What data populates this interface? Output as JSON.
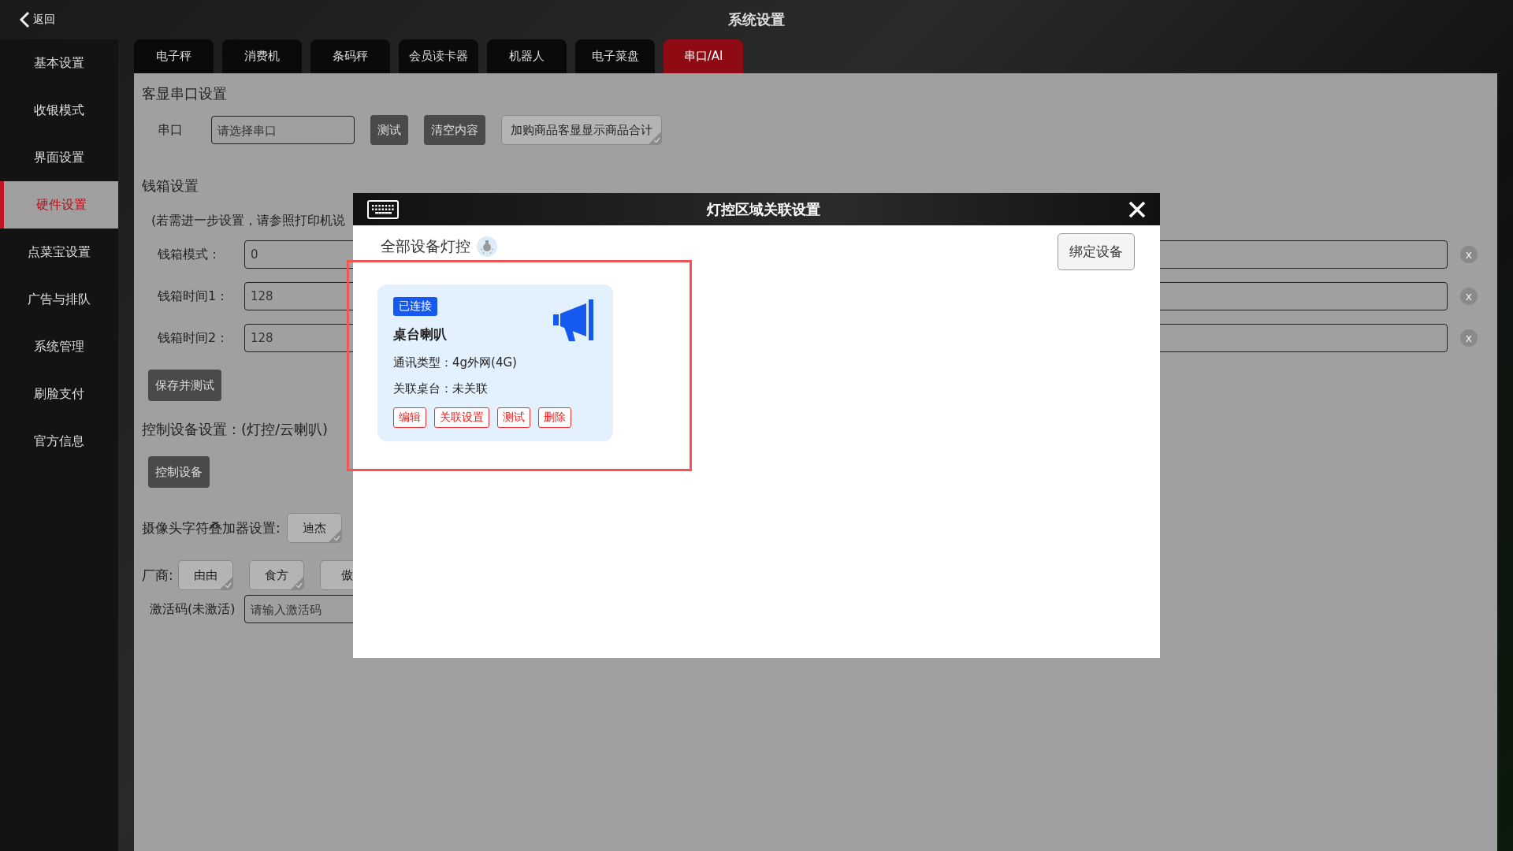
{
  "header": {
    "back": "返回",
    "title": "系统设置"
  },
  "sidebar": {
    "items": [
      {
        "label": "基本设置",
        "selected": false
      },
      {
        "label": "收银模式",
        "selected": false
      },
      {
        "label": "界面设置",
        "selected": false
      },
      {
        "label": "硬件设置",
        "selected": true
      },
      {
        "label": "点菜宝设置",
        "selected": false
      },
      {
        "label": "广告与排队",
        "selected": false
      },
      {
        "label": "系统管理",
        "selected": false
      },
      {
        "label": "刷脸支付",
        "selected": false
      },
      {
        "label": "官方信息",
        "selected": false
      }
    ]
  },
  "tabs": [
    {
      "label": "电子秤",
      "selected": false
    },
    {
      "label": "消费机",
      "selected": false
    },
    {
      "label": "条码秤",
      "selected": false
    },
    {
      "label": "会员读卡器",
      "selected": false
    },
    {
      "label": "机器人",
      "selected": false
    },
    {
      "label": "电子菜盘",
      "selected": false
    },
    {
      "label": "串口/AI",
      "selected": true
    }
  ],
  "display_port": {
    "heading": "客显串口设置",
    "label": "串口",
    "placeholder": "请选择串口",
    "buttons": [
      "测试",
      "清空内容"
    ],
    "option": "加购商品客显显示商品合计"
  },
  "cash_drawer": {
    "heading": "钱箱设置",
    "note": "(若需进一步设置，请参照打印机说",
    "fields": [
      {
        "label": "钱箱模式：",
        "value": "0",
        "clear": "x"
      },
      {
        "label": "钱箱时间1：",
        "value": "128",
        "clear": "x"
      },
      {
        "label": "钱箱时间2：",
        "value": "128",
        "clear": "x"
      }
    ],
    "button": "保存并测试"
  },
  "control": {
    "heading": "控制设备设置：(灯控/云喇叭)",
    "button": "控制设备"
  },
  "camera": {
    "label": "摄像头字符叠加器设置:",
    "option": "迪杰"
  },
  "vendors": {
    "label": "厂商:",
    "options": [
      "由由",
      "食方",
      "傲"
    ]
  },
  "activation": {
    "label": "激活码(未激活)",
    "placeholder": "请输入激活码"
  },
  "modal": {
    "title": "灯控区域关联设置",
    "heading": "全部设备灯控",
    "bind_button": "绑定设备",
    "devices": [
      {
        "status": "已连接",
        "connected": true,
        "name": "桌台喇叭",
        "lines": [
          "通讯类型：4g外网(4G)",
          "关联桌台：未关联"
        ],
        "actions": [
          "编辑",
          "关联设置",
          "测试",
          "删除"
        ]
      }
    ]
  }
}
